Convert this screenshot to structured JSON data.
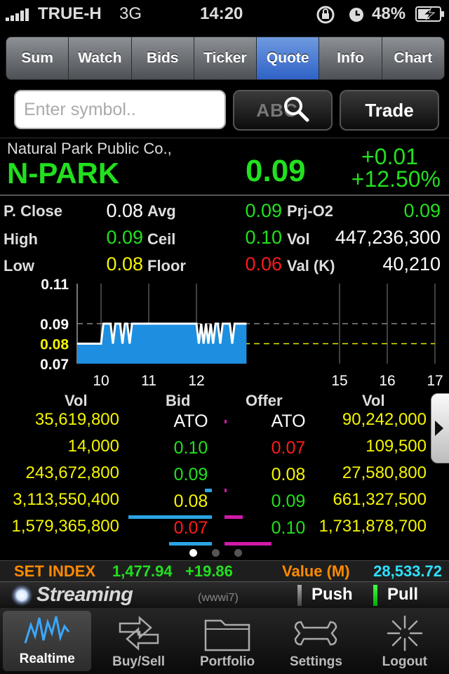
{
  "status_bar": {
    "carrier": "TRUE-H",
    "network": "3G",
    "time": "14:20",
    "battery": "48%"
  },
  "tabs": [
    {
      "label": "Sum",
      "active": false
    },
    {
      "label": "Watch",
      "active": false
    },
    {
      "label": "Bids",
      "active": false
    },
    {
      "label": "Ticker",
      "active": false
    },
    {
      "label": "Quote",
      "active": true
    },
    {
      "label": "Info",
      "active": false
    },
    {
      "label": "Chart",
      "active": false
    }
  ],
  "search": {
    "placeholder": "Enter symbol..",
    "value": "",
    "abc_label": "ABC",
    "trade_label": "Trade"
  },
  "stock": {
    "company": "Natural Park Public Co.,",
    "symbol": "N-PARK",
    "last": "0.09",
    "change": "+0.01",
    "change_pct": "+12.50%"
  },
  "stats": {
    "prev_close_label": "P. Close",
    "prev_close": "0.08",
    "avg_label": "Avg",
    "avg": "0.09",
    "prj_label": "Prj-O2",
    "prj": "0.09",
    "high_label": "High",
    "high": "0.09",
    "ceil_label": "Ceil",
    "ceil": "0.10",
    "vol_label": "Vol",
    "vol": "447,236,300",
    "low_label": "Low",
    "low": "0.08",
    "floor_label": "Floor",
    "floor": "0.06",
    "val_label": "Val (K)",
    "val": "40,210"
  },
  "chart_data": {
    "type": "area",
    "y_ticks": [
      "0.11",
      "0.09",
      "0.08",
      "0.07"
    ],
    "x_ticks": [
      "10",
      "11",
      "12",
      "15",
      "16",
      "17"
    ],
    "ylim": [
      0.07,
      0.11
    ],
    "xlim": [
      9.5,
      17
    ],
    "prev_close": 0.08,
    "x": [
      9.5,
      10.0,
      10.05,
      10.1,
      10.2,
      10.25,
      10.3,
      10.4,
      10.45,
      10.5,
      10.55,
      10.6,
      10.65,
      10.8,
      12.0,
      12.05,
      12.1,
      12.15,
      12.2,
      12.25,
      12.3,
      12.35,
      12.4,
      12.45,
      12.5,
      12.55,
      12.6,
      12.7,
      12.75,
      12.8,
      13.05
    ],
    "y": [
      0.08,
      0.08,
      0.09,
      0.09,
      0.09,
      0.08,
      0.09,
      0.09,
      0.08,
      0.09,
      0.09,
      0.08,
      0.09,
      0.09,
      0.09,
      0.08,
      0.09,
      0.08,
      0.09,
      0.08,
      0.09,
      0.08,
      0.09,
      0.09,
      0.08,
      0.09,
      0.09,
      0.09,
      0.08,
      0.09,
      0.09
    ],
    "grid": true
  },
  "orderbook": {
    "headers": {
      "bid_vol": "Vol",
      "bid": "Bid",
      "offer": "Offer",
      "offer_vol": "Vol"
    },
    "rows": [
      {
        "bid_vol": "35,619,800",
        "bid": "ATO",
        "bid_color": "#ffffff",
        "offer": "ATO",
        "offer_color": "#ffffff",
        "offer_vol": "90,242,000"
      },
      {
        "bid_vol": "14,000",
        "bid": "0.10",
        "bid_color": "#22e01e",
        "offer": "0.07",
        "offer_color": "#ff1a1a",
        "offer_vol": "109,500"
      },
      {
        "bid_vol": "243,672,800",
        "bid": "0.09",
        "bid_color": "#22e01e",
        "offer": "0.08",
        "offer_color": "#f5f500",
        "offer_vol": "27,580,800"
      },
      {
        "bid_vol": "3,113,550,400",
        "bid": "0.08",
        "bid_color": "#f5f500",
        "offer": "0.09",
        "offer_color": "#22e01e",
        "offer_vol": "661,327,500"
      },
      {
        "bid_vol": "1,579,365,800",
        "bid": "0.07",
        "bid_color": "#ff1a1a",
        "offer": "0.10",
        "offer_color": "#22e01e",
        "offer_vol": "1,731,878,700"
      }
    ],
    "bid_bar_fraction": [
      0,
      0,
      0.06,
      0.7,
      0.36
    ],
    "offer_bar_fraction": [
      0,
      0.03,
      0.01,
      0.3,
      0.78
    ]
  },
  "pager": {
    "count": 3,
    "active": 0
  },
  "index_bar": {
    "label": "SET INDEX",
    "value": "1,477.94",
    "change": "+19.86",
    "value_label": "Value (M)",
    "value_m": "28,533.72"
  },
  "stream_bar": {
    "logo": "Streaming",
    "user": "(wwwi7)",
    "push": "Push",
    "pull": "Pull"
  },
  "bottom_tabs": [
    {
      "label": "Realtime",
      "icon": "realtime-icon",
      "active": true
    },
    {
      "label": "Buy/Sell",
      "icon": "buy-sell-icon",
      "active": false
    },
    {
      "label": "Portfolio",
      "icon": "portfolio-icon",
      "active": false
    },
    {
      "label": "Settings",
      "icon": "settings-icon",
      "active": false
    },
    {
      "label": "Logout",
      "icon": "logout-icon",
      "active": false
    }
  ],
  "colors": {
    "up": "#22e01e",
    "unchanged": "#f5f500",
    "down": "#ff1a1a",
    "accent": "#2f62c6",
    "area": "#1e8fe0",
    "index_label": "#ff8a00",
    "value_m": "#2de0ff"
  }
}
